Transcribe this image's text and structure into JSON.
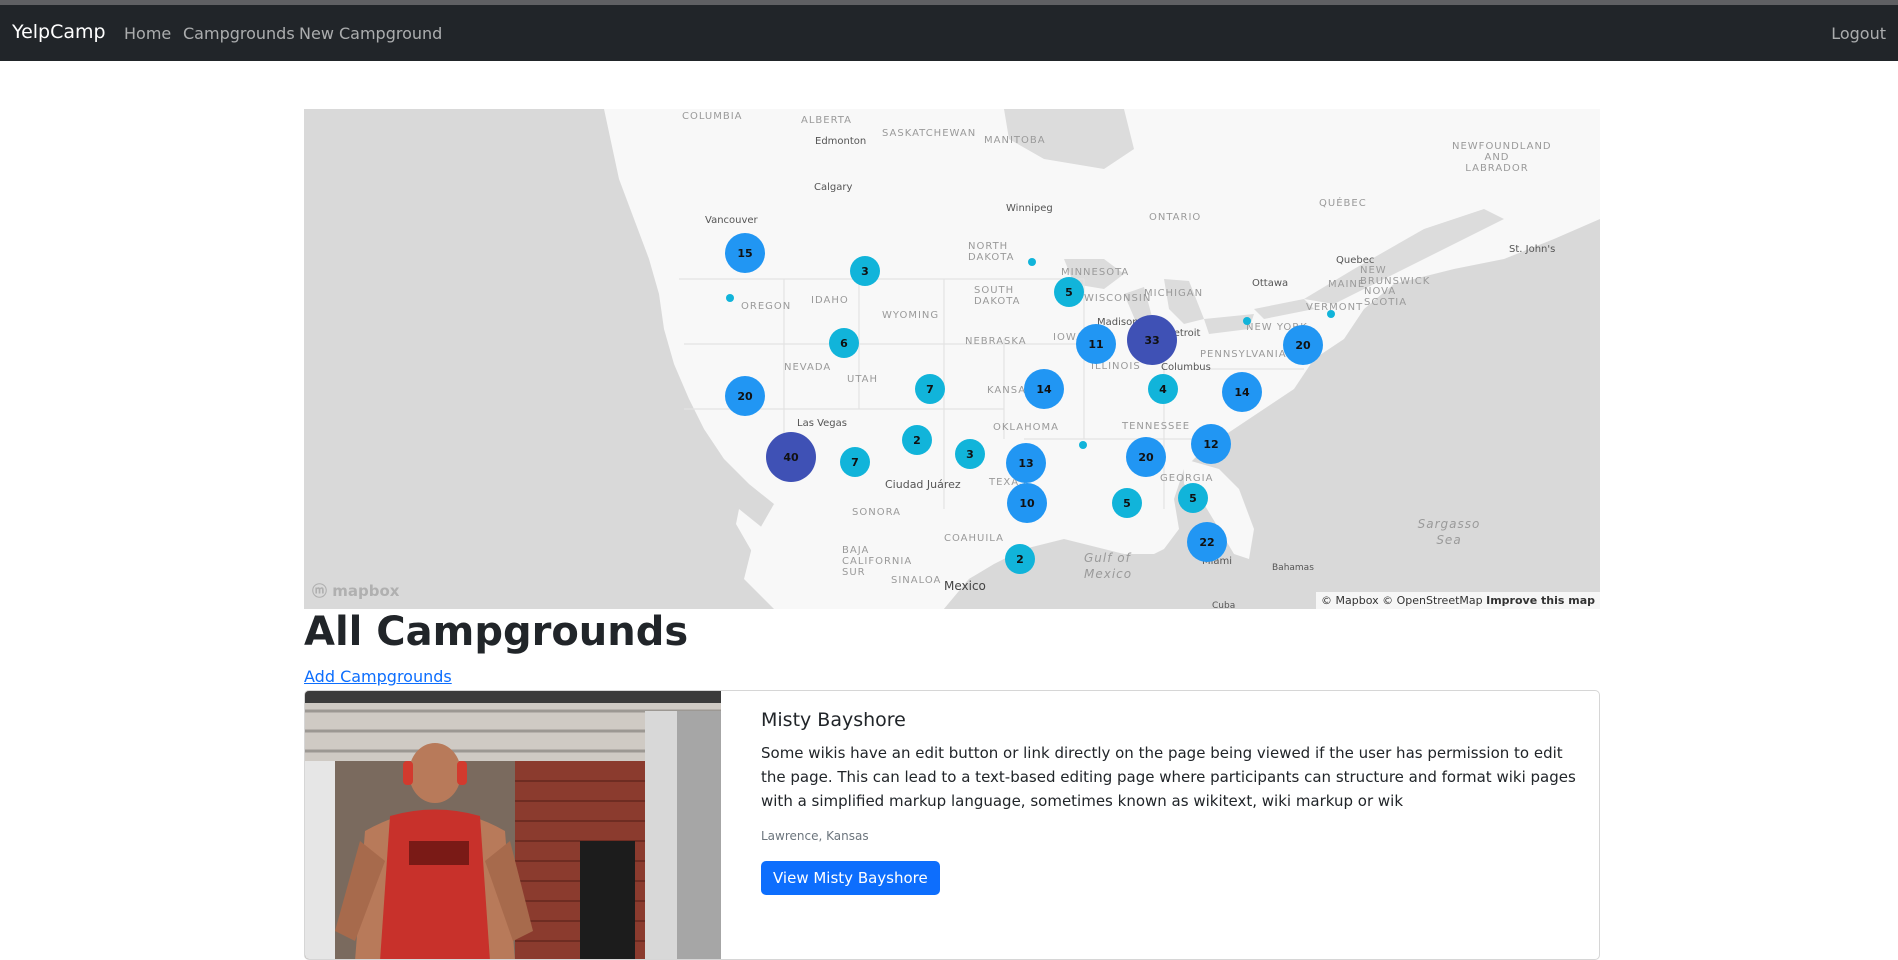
{
  "navbar": {
    "brand": "YelpCamp",
    "links": [
      "Home",
      "Campgrounds",
      "New Campground"
    ],
    "logout": "Logout"
  },
  "map": {
    "logo": "mapbox",
    "attribution": "© Mapbox © OpenStreetMap",
    "improve": "Improve this map",
    "region_labels": [
      "COLUMBIA",
      "ALBERTA",
      "SASKATCHEWAN",
      "MANITOBA",
      "NEWFOUNDLAND AND LABRADOR",
      "ONTARIO",
      "QUÉBEC",
      "NORTH DAKOTA",
      "MINNESOTA",
      "SOUTH DAKOTA",
      "WISCONSIN",
      "MICHIGAN",
      "OREGON",
      "IDAHO",
      "WYOMING",
      "NEBRASKA",
      "IOWA",
      "NEW YORK",
      "MAINE",
      "NEVADA",
      "UTAH",
      "KANSAS",
      "ILLINOIS",
      "PENNSYLVANIA",
      "NEW BRUNSWICK",
      "NOVA SCOTIA",
      "VERMONT",
      "OKLAHOMA",
      "TENNESSEE",
      "GEORGIA",
      "SONORA",
      "COAHUILA",
      "BAJA CALIFORNIA SUR",
      "SINALOA",
      "TEXAS",
      "Gulf of Mexico",
      "Sargasso Sea"
    ],
    "city_labels": [
      "Edmonton",
      "Calgary",
      "Winnipeg",
      "Vancouver",
      "Ottawa",
      "Quebec",
      "St. John's",
      "Madison",
      "Detroit",
      "Columbus",
      "Las Vegas",
      "Ciudad Juárez",
      "Mexico",
      "Miami",
      "Bahamas",
      "Cuba"
    ],
    "clusters": [
      {
        "count": "15",
        "tier": "mid"
      },
      {
        "count": "3",
        "tier": "low"
      },
      {
        "count": "5",
        "tier": "low"
      },
      {
        "count": "6",
        "tier": "low"
      },
      {
        "count": "11",
        "tier": "mid"
      },
      {
        "count": "33",
        "tier": "high"
      },
      {
        "count": "20",
        "tier": "mid"
      },
      {
        "count": "7",
        "tier": "low"
      },
      {
        "count": "20",
        "tier": "mid"
      },
      {
        "count": "14",
        "tier": "mid"
      },
      {
        "count": "4",
        "tier": "low"
      },
      {
        "count": "14",
        "tier": "mid"
      },
      {
        "count": "40",
        "tier": "high"
      },
      {
        "count": "2",
        "tier": "low"
      },
      {
        "count": "3",
        "tier": "low"
      },
      {
        "count": "7",
        "tier": "low"
      },
      {
        "count": "13",
        "tier": "mid"
      },
      {
        "count": "20",
        "tier": "mid"
      },
      {
        "count": "12",
        "tier": "mid"
      },
      {
        "count": "10",
        "tier": "mid"
      },
      {
        "count": "5",
        "tier": "low"
      },
      {
        "count": "5",
        "tier": "low"
      },
      {
        "count": "22",
        "tier": "mid"
      },
      {
        "count": "2",
        "tier": "low"
      }
    ],
    "colors": {
      "low": "#11b4da",
      "mid": "#2196f3",
      "high": "#3f51b5"
    }
  },
  "page": {
    "title": "All Campgrounds",
    "add_link": "Add Campgrounds"
  },
  "campground": {
    "title": "Misty Bayshore",
    "description": "Some wikis have an edit button or link directly on the page being viewed if the user has permission to edit the page. This can lead to a text-based editing page where participants can structure and format wiki pages with a simplified markup language, sometimes known as wikitext, wiki markup or wik",
    "location": "Lawrence, Kansas",
    "button": "View Misty Bayshore",
    "image_alt": "man in red tank top in gym"
  }
}
